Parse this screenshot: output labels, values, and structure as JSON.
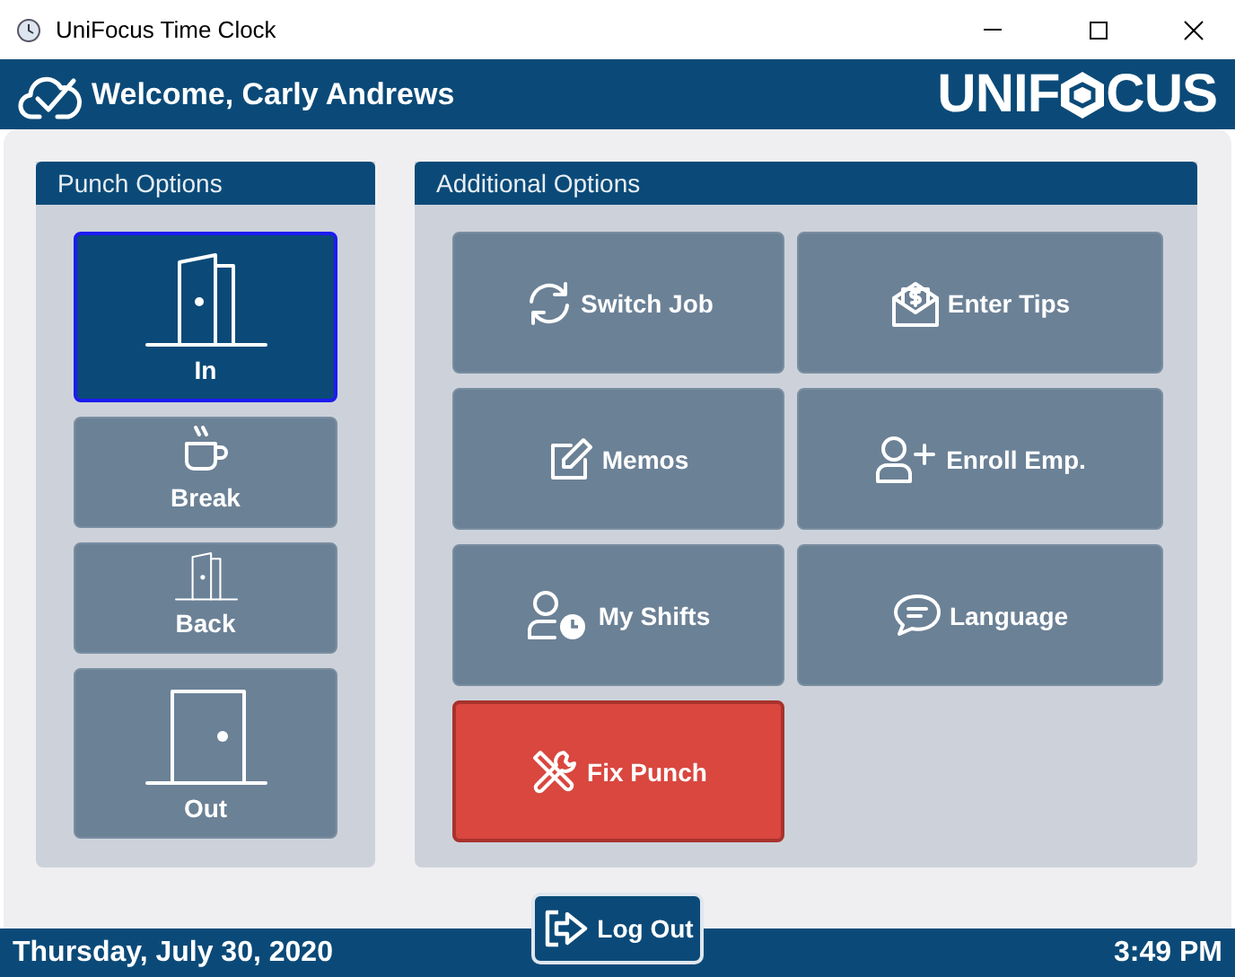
{
  "window": {
    "title": "UniFocus Time Clock"
  },
  "header": {
    "welcome": "Welcome, Carly Andrews",
    "logo_left": "UNIF",
    "logo_right": "CUS"
  },
  "punch_options": {
    "title": "Punch Options",
    "items": [
      {
        "label": "In",
        "selected": true
      },
      {
        "label": "Break",
        "selected": false
      },
      {
        "label": "Back",
        "selected": false
      },
      {
        "label": "Out",
        "selected": false
      }
    ]
  },
  "additional_options": {
    "title": "Additional Options",
    "items": [
      {
        "label": "Switch Job",
        "kind": "normal"
      },
      {
        "label": "Enter Tips",
        "kind": "normal"
      },
      {
        "label": "Memos",
        "kind": "normal"
      },
      {
        "label": "Enroll Emp.",
        "kind": "normal"
      },
      {
        "label": "My Shifts",
        "kind": "normal"
      },
      {
        "label": "Language",
        "kind": "normal"
      },
      {
        "label": "Fix Punch",
        "kind": "alert"
      }
    ]
  },
  "logout": {
    "label": "Log Out"
  },
  "status_bar": {
    "date": "Thursday, July 30, 2020",
    "time": "3:49 PM"
  }
}
